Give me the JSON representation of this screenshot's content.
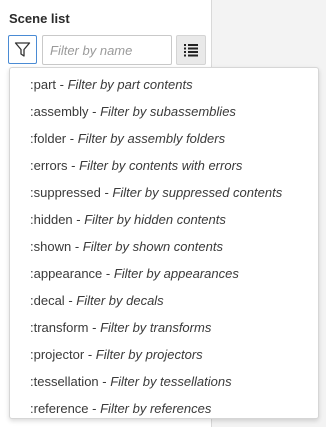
{
  "panel": {
    "title": "Scene list",
    "search": {
      "placeholder": "Filter by name",
      "value": ""
    }
  },
  "icons": {
    "filter": "funnel-icon",
    "list": "list-view-icon"
  },
  "dropdown": {
    "items": [
      {
        "keyword": ":part",
        "sep": " - ",
        "desc": "Filter by part contents"
      },
      {
        "keyword": ":assembly",
        "sep": " - ",
        "desc": "Filter by subassemblies"
      },
      {
        "keyword": ":folder",
        "sep": " - ",
        "desc": "Filter by assembly folders"
      },
      {
        "keyword": ":errors",
        "sep": " - ",
        "desc": "Filter by contents with errors"
      },
      {
        "keyword": ":suppressed",
        "sep": " - ",
        "desc": "Filter by suppressed contents"
      },
      {
        "keyword": ":hidden",
        "sep": " - ",
        "desc": "Filter by hidden contents"
      },
      {
        "keyword": ":shown",
        "sep": " - ",
        "desc": "Filter by shown contents"
      },
      {
        "keyword": ":appearance",
        "sep": " - ",
        "desc": "Filter by appearances"
      },
      {
        "keyword": ":decal",
        "sep": " - ",
        "desc": "Filter by decals"
      },
      {
        "keyword": ":transform",
        "sep": " - ",
        "desc": "Filter by transforms"
      },
      {
        "keyword": ":projector",
        "sep": " - ",
        "desc": "Filter by projectors"
      },
      {
        "keyword": ":tessellation",
        "sep": " - ",
        "desc": "Filter by tessellations"
      },
      {
        "keyword": ":reference",
        "sep": " - ",
        "desc": "Filter by references"
      }
    ]
  }
}
